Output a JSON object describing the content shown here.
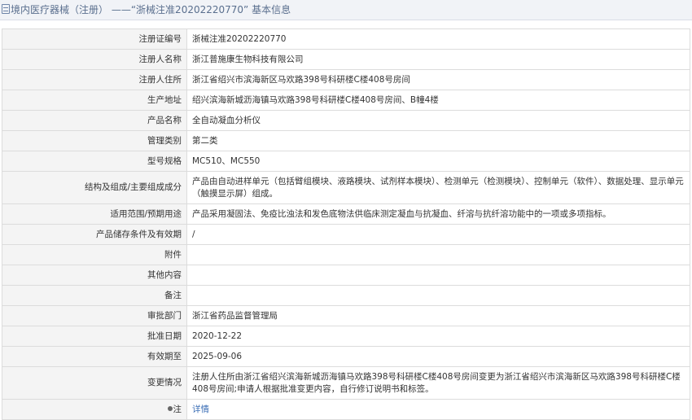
{
  "title": {
    "prefix": "境内医疗器械（注册）",
    "separator": "——",
    "reg_quoted": "“浙械注准20202220770”",
    "suffix": "基本信息"
  },
  "rows": [
    {
      "label": "注册证编号",
      "value": "浙械注准20202220770"
    },
    {
      "label": "注册人名称",
      "value": "浙江普施康生物科技有限公司"
    },
    {
      "label": "注册人住所",
      "value": "浙江省绍兴市滨海新区马欢路398号科研楼C楼408号房间"
    },
    {
      "label": "生产地址",
      "value": "绍兴滨海新城沥海镇马欢路398号科研楼C楼408号房间、B幢4楼"
    },
    {
      "label": "产品名称",
      "value": "全自动凝血分析仪"
    },
    {
      "label": "管理类别",
      "value": "第二类"
    },
    {
      "label": "型号规格",
      "value": "MC510、MC550"
    },
    {
      "label": "结构及组成/主要组成成分",
      "value": "产品由自动进样单元（包括臂组模块、液路模块、试剂样本模块）、检测单元（检测模块）、控制单元（软件）、数据处理、显示单元（触摸显示屏）组成。"
    },
    {
      "label": "适用范围/预期用途",
      "value": "产品采用凝固法、免疫比浊法和发色底物法供临床测定凝血与抗凝血、纤溶与抗纤溶功能中的一项或多项指标。"
    },
    {
      "label": "产品储存条件及有效期",
      "value": "/"
    },
    {
      "label": "附件",
      "value": ""
    },
    {
      "label": "其他内容",
      "value": ""
    },
    {
      "label": "备注",
      "value": ""
    },
    {
      "label": "审批部门",
      "value": "浙江省药品监督管理局"
    },
    {
      "label": "批准日期",
      "value": "2020-12-22"
    },
    {
      "label": "有效期至",
      "value": "2025-09-06"
    },
    {
      "label": "变更情况",
      "value": "注册人住所由浙江省绍兴滨海新城沥海镇马欢路398号科研楼C楼408号房间变更为浙江省绍兴市滨海新区马欢路398号科研楼C楼408号房间;申请人根据批准变更内容，自行修订说明书和标签。"
    }
  ],
  "note_row": {
    "label": "注",
    "link": "详情"
  }
}
